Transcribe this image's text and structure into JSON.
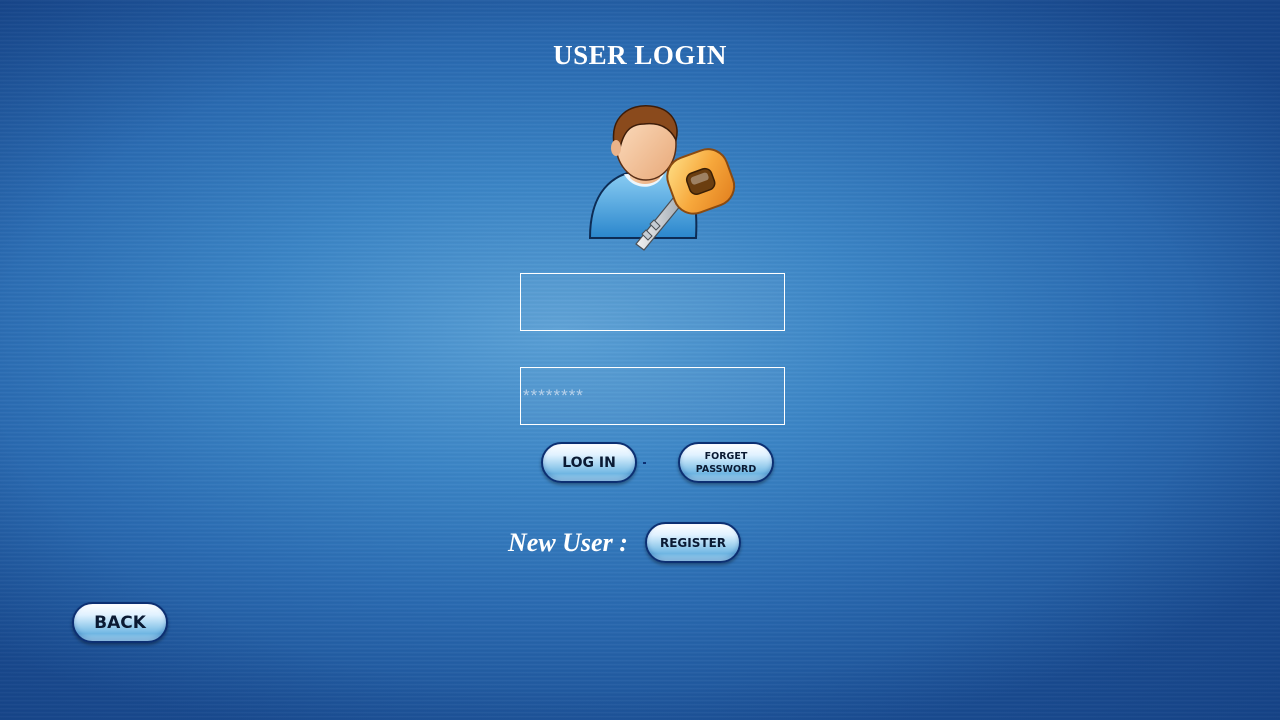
{
  "page": {
    "title": "USER LOGIN"
  },
  "icons": {
    "avatar": "user-with-key-icon"
  },
  "form": {
    "username": {
      "value": "",
      "placeholder": ""
    },
    "password": {
      "value": "",
      "placeholder": "********"
    },
    "login_label": "LOG IN",
    "forget_line1": "FORGET",
    "forget_line2": "PASSWORD"
  },
  "register": {
    "prompt": "New User :",
    "button_label": "REGISTER"
  },
  "nav": {
    "back_label": "BACK"
  },
  "colors": {
    "background": "#3b85c6",
    "button_border": "#0c2f72",
    "text": "#ffffff"
  }
}
